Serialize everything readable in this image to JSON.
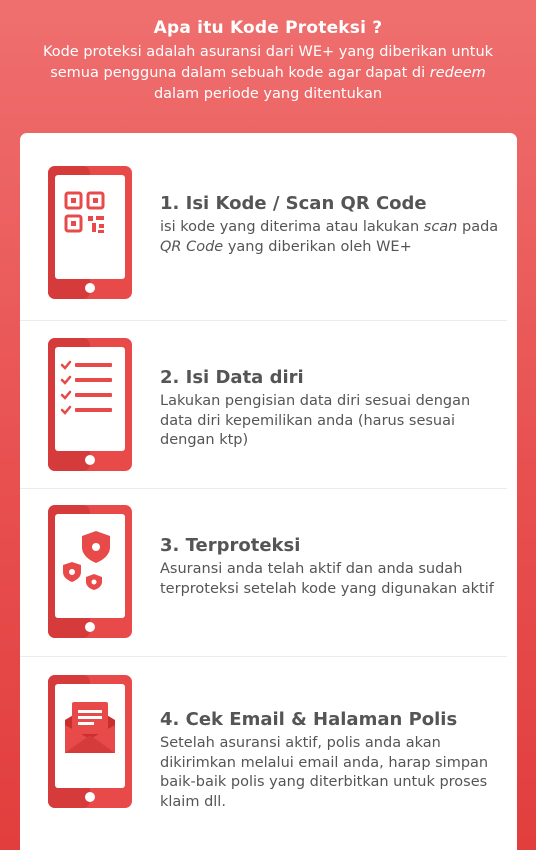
{
  "header": {
    "title": "Apa itu Kode Proteksi ?",
    "desc_part1": "Kode proteksi adalah asuransi dari WE+ yang diberikan untuk semua pengguna dalam sebuah kode agar dapat di",
    "desc_italic": "redeem",
    "desc_part2": "dalam periode yang ditentukan"
  },
  "steps": [
    {
      "icon": "qr-code-icon",
      "title": "1. Isi Kode / Scan QR Code",
      "desc_a": "isi kode yang diterima atau lakukan",
      "desc_italic1": "scan",
      "desc_b": "pada",
      "desc_italic2": "QR Code",
      "desc_c": "yang diberikan oleh WE+"
    },
    {
      "icon": "checklist-icon",
      "title": "2. Isi Data diri",
      "desc": "Lakukan pengisian data diri sesuai dengan data diri kepemilikan anda (harus sesuai dengan ktp)"
    },
    {
      "icon": "shield-icon",
      "title": "3. Terproteksi",
      "desc": "Asuransi anda telah aktif dan anda sudah terproteksi setelah kode yang digunakan aktif"
    },
    {
      "icon": "email-icon",
      "title": "4. Cek Email & Halaman Polis",
      "desc": "Setelah asuransi aktif, polis anda akan dikirimkan melalui email anda, harap simpan baik-baik polis yang diterbitkan untuk proses klaim dll."
    }
  ],
  "colors": {
    "accent": "#e84a4a",
    "background_top": "#ef6f6f",
    "background_bottom": "#e23e3e",
    "text": "#555555"
  }
}
